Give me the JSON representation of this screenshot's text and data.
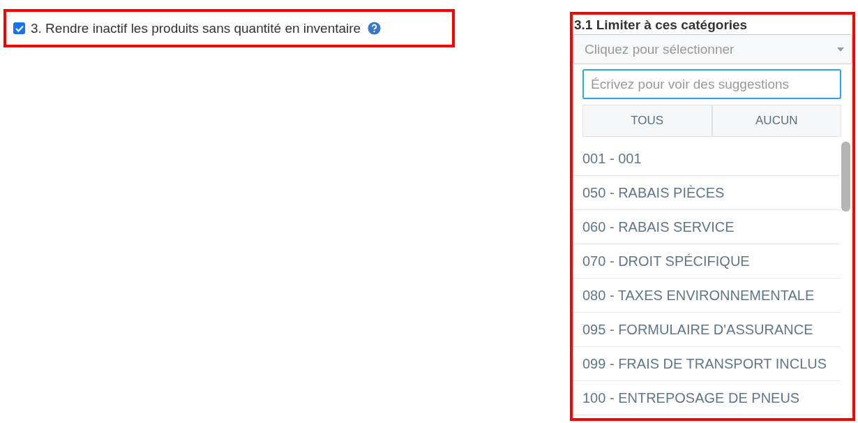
{
  "option": {
    "label": "3. Rendre inactif les produits sans quantité en inventaire",
    "checked": true
  },
  "categories": {
    "label": "3.1 Limiter à ces catégories",
    "select_placeholder": "Cliquez pour sélectionner",
    "search_placeholder": "Écrivez pour voir des suggestions",
    "buttons": [
      "TOUS",
      "AUCUN"
    ],
    "items": [
      "001 - 001",
      "050 - RABAIS PIÈCES",
      "060 - RABAIS SERVICE",
      "070 - DROIT SPÉCIFIQUE",
      "080 - TAXES ENVIRONNEMENTALE",
      "095 - FORMULAIRE D'ASSURANCE",
      "099 - FRAIS DE TRANSPORT INCLUS",
      "100 - ENTREPOSAGE DE PNEUS"
    ]
  }
}
